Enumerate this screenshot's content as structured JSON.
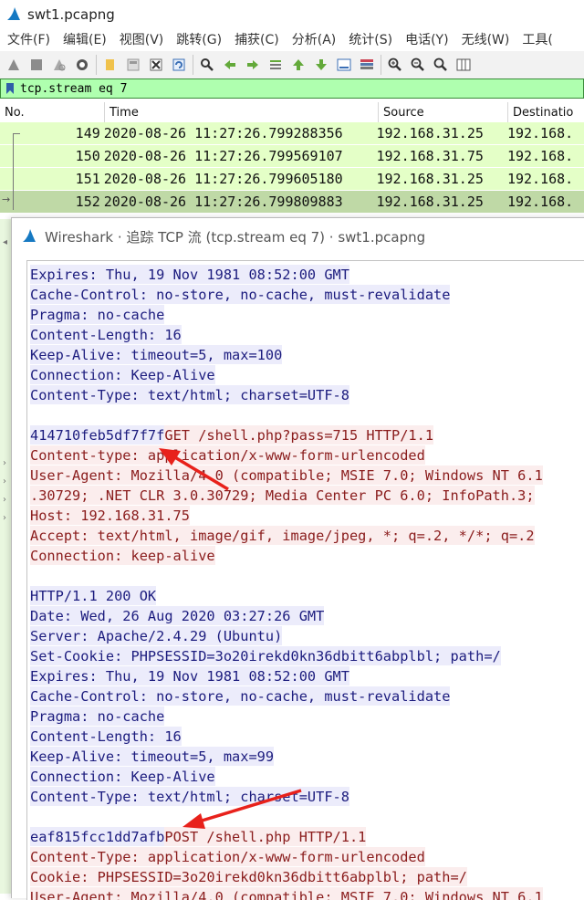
{
  "window": {
    "title": "swt1.pcapng"
  },
  "menu": [
    "文件(F)",
    "编辑(E)",
    "视图(V)",
    "跳转(G)",
    "捕获(C)",
    "分析(A)",
    "统计(S)",
    "电话(Y)",
    "无线(W)",
    "工具("
  ],
  "toolbar": {
    "icons": [
      "start-capture-icon",
      "stop-capture-icon",
      "restart-capture-icon",
      "capture-options-icon",
      "open-file-icon",
      "save-file-icon",
      "close-file-icon",
      "reload-file-icon",
      "find-packet-icon",
      "go-back-icon",
      "go-forward-icon",
      "go-to-packet-icon",
      "go-first-icon",
      "go-last-icon",
      "auto-scroll-icon",
      "colorize-icon",
      "zoom-in-icon",
      "zoom-out-icon",
      "zoom-normal-icon",
      "resize-columns-icon"
    ]
  },
  "filter": {
    "value": "tcp.stream eq 7"
  },
  "packet_list": {
    "columns": [
      "No.",
      "Time",
      "Source",
      "Destinatio"
    ],
    "rows": [
      {
        "no": "149",
        "time": "2020-08-26 11:27:26.799288356",
        "source": "192.168.31.25",
        "dest": "192.168."
      },
      {
        "no": "150",
        "time": "2020-08-26 11:27:26.799569107",
        "source": "192.168.31.75",
        "dest": "192.168."
      },
      {
        "no": "151",
        "time": "2020-08-26 11:27:26.799605180",
        "source": "192.168.31.25",
        "dest": "192.168."
      },
      {
        "no": "152",
        "time": "2020-08-26 11:27:26.799809883",
        "source": "192.168.31.25",
        "dest": "192.168."
      }
    ],
    "selected_row": 3
  },
  "dialog": {
    "title": "Wireshark · 追踪 TCP 流 (tcp.stream eq 7) · swt1.pcapng",
    "lines": [
      {
        "dir": "server",
        "text": "Expires: Thu, 19 Nov 1981 08:52:00 GMT"
      },
      {
        "dir": "server",
        "text": "Cache-Control: no-store, no-cache, must-revalidate"
      },
      {
        "dir": "server",
        "text": "Pragma: no-cache"
      },
      {
        "dir": "server",
        "text": "Content-Length: 16"
      },
      {
        "dir": "server",
        "text": "Keep-Alive: timeout=5, max=100"
      },
      {
        "dir": "server",
        "text": "Connection: Keep-Alive"
      },
      {
        "dir": "server",
        "text": "Content-Type: text/html; charset=UTF-8"
      },
      {
        "dir": "blank",
        "text": ""
      },
      {
        "dir": "mixed",
        "hash": "414710feb5df7f7f",
        "text": "GET /shell.php?pass=715 HTTP/1.1"
      },
      {
        "dir": "client",
        "text": "Content-type: application/x-www-form-urlencoded"
      },
      {
        "dir": "client",
        "text": "User-Agent: Mozilla/4.0 (compatible; MSIE 7.0; Windows NT 6.1"
      },
      {
        "dir": "client",
        "text": ".30729; .NET CLR 3.0.30729; Media Center PC 6.0; InfoPath.3;"
      },
      {
        "dir": "client",
        "text": "Host: 192.168.31.75"
      },
      {
        "dir": "client",
        "text": "Accept: text/html, image/gif, image/jpeg, *; q=.2, */*; q=.2"
      },
      {
        "dir": "client",
        "text": "Connection: keep-alive"
      },
      {
        "dir": "blank",
        "text": ""
      },
      {
        "dir": "server",
        "text": "HTTP/1.1 200 OK"
      },
      {
        "dir": "server",
        "text": "Date: Wed, 26 Aug 2020 03:27:26 GMT"
      },
      {
        "dir": "server",
        "text": "Server: Apache/2.4.29 (Ubuntu)"
      },
      {
        "dir": "server",
        "text": "Set-Cookie: PHPSESSID=3o20irekd0kn36dbitt6abplbl; path=/"
      },
      {
        "dir": "server",
        "text": "Expires: Thu, 19 Nov 1981 08:52:00 GMT"
      },
      {
        "dir": "server",
        "text": "Cache-Control: no-store, no-cache, must-revalidate"
      },
      {
        "dir": "server",
        "text": "Pragma: no-cache"
      },
      {
        "dir": "server",
        "text": "Content-Length: 16"
      },
      {
        "dir": "server",
        "text": "Keep-Alive: timeout=5, max=99"
      },
      {
        "dir": "server",
        "text": "Connection: Keep-Alive"
      },
      {
        "dir": "server",
        "text": "Content-Type: text/html; charset=UTF-8"
      },
      {
        "dir": "blank",
        "text": ""
      },
      {
        "dir": "mixed",
        "hash": "eaf815fcc1dd7afb",
        "text": "POST /shell.php HTTP/1.1"
      },
      {
        "dir": "client",
        "text": "Content-Type: application/x-www-form-urlencoded"
      },
      {
        "dir": "client",
        "text": "Cookie: PHPSESSID=3o20irekd0kn36dbitt6abplbl; path=/"
      },
      {
        "dir": "client",
        "text": "User-Agent: Mozilla/4.0 (compatible; MSIE 7.0; Windows NT 6.1"
      }
    ]
  },
  "annotations": {
    "arrow_color": "#e8211b"
  },
  "colors": {
    "server_bg": "#ececfb",
    "server_fg": "#1c1c7e",
    "client_bg": "#fbeded",
    "client_fg": "#8a1c1c",
    "filter_bg": "#afffaf",
    "row_bg": "#e4ffc7",
    "row_selected": "#bfd9a6"
  }
}
